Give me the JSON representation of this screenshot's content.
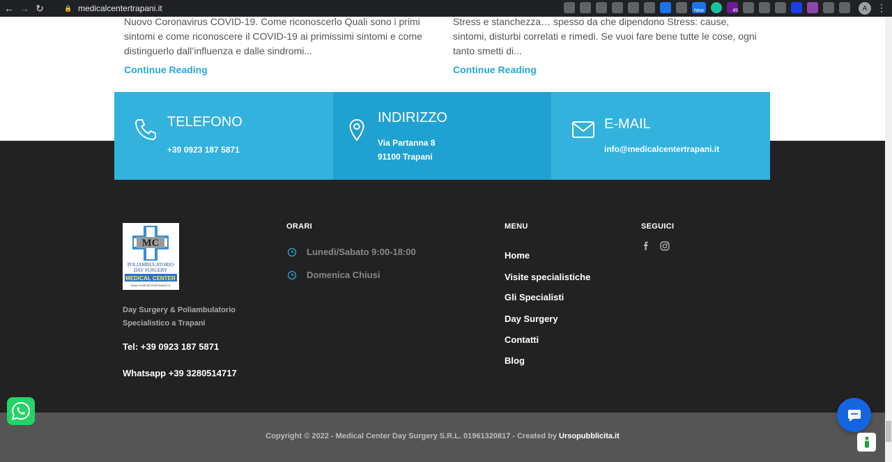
{
  "browser": {
    "url": "medicalcentertrapani.it",
    "profile_initial": "A",
    "ext_badge_new": "New",
    "ext_badge_count": "45"
  },
  "blog": {
    "left_excerpt": "Nuovo Coronavirus COVID-19. Come riconoscerlo Quali sono i primi sintomi e come riconoscere il COVID-19 ai primissimi sintomi e come distinguerlo dall’influenza e dalle sindromi...",
    "right_excerpt": "Stress e stanchezza… spesso da che dipendono Stress: cause, sintomi, disturbi correlati e rimedi. Se vuoi fare bene tutte le cose, ogni tanto smetti di...",
    "continue_label": "Continue Reading"
  },
  "contact": {
    "phone_title": "TELEFONO",
    "phone_value": "+39 0923 187 5871",
    "address_title": "INDIRIZZO",
    "address_line1": "Via Partanna 8",
    "address_line2": "91100 Trapani",
    "email_title": "E-MAIL",
    "email_value": "info@medicalcentertrapani.it"
  },
  "footer": {
    "logo": {
      "initials": "MC",
      "line1": "POLIAMBULATORIO",
      "line2": "DAY SURGERY",
      "line3": "MEDICAL CENTER",
      "line4": "www.medicalcentertrapani.it"
    },
    "description_line1": "Day Surgery & Poliambulatorio",
    "description_line2": "Specialistico a Trapani",
    "tel": "Tel: +39 0923 187 5871",
    "whatsapp": "Whatsapp +39 3280514717",
    "orari_heading": "ORARI",
    "orari": [
      "Lunedì/Sabato 9:00-18:00",
      "Domenica Chiusi"
    ],
    "menu_heading": "MENU",
    "menu": [
      "Home",
      "Visite specialistiche",
      "Gli Specialisti",
      "Day Surgery",
      "Contatti",
      "Blog"
    ],
    "seguici_heading": "SEGUICI",
    "social_icons": [
      "facebook-icon",
      "instagram-icon"
    ]
  },
  "bottom": {
    "copyright": "Copyright © 2022  - Medical Center Day Surgery S.R.L. 01961320817 - Created by ",
    "credit": "Ursopubblicita.it"
  },
  "colors": {
    "band_light": "#32b2dd",
    "band_dark": "#1fa2d1",
    "link": "#2aa7d4",
    "footer_bg": "#222222",
    "bottom_bg": "#555555",
    "whatsapp": "#25d366",
    "chat": "#1565e0"
  }
}
